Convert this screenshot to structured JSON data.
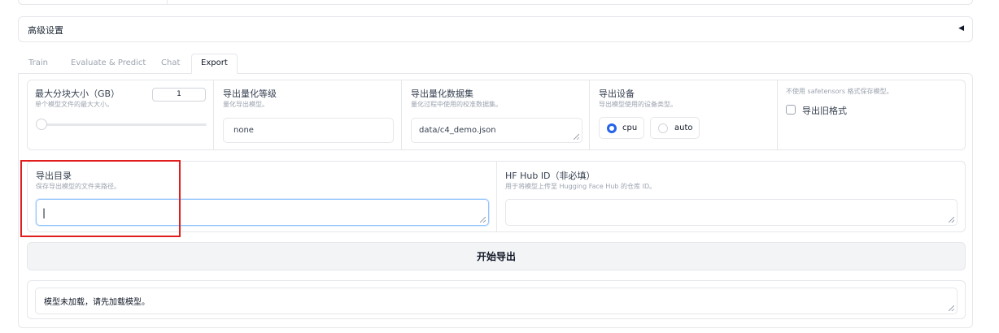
{
  "advanced": {
    "label": "高级设置",
    "toggle_icon": "◀"
  },
  "tabs": [
    {
      "label": "Train"
    },
    {
      "label": "Evaluate & Predict"
    },
    {
      "label": "Chat"
    },
    {
      "label": "Export"
    }
  ],
  "export": {
    "max_shard": {
      "title": "最大分块大小（GB）",
      "desc": "单个模型文件的最大大小。",
      "value": "1",
      "slider_fraction": 0.0
    },
    "quant_bit": {
      "title": "导出量化等级",
      "desc": "量化导出模型。",
      "value": "none"
    },
    "quant_dataset": {
      "title": "导出量化数据集",
      "desc": "量化过程中使用的校准数据集。",
      "value": "data/c4_demo.json"
    },
    "device": {
      "title": "导出设备",
      "desc": "导出模型使用的设备类型。",
      "options": [
        "cpu",
        "auto"
      ],
      "selected": "cpu"
    },
    "legacy": {
      "desc": "不使用 safetensors 格式保存模型。",
      "label": "导出旧格式",
      "checked": false
    },
    "export_dir": {
      "title": "导出目录",
      "desc": "保存导出模型的文件夹路径。",
      "value": "|"
    },
    "hub_id": {
      "title": "HF Hub ID（非必填）",
      "desc": "用于将模型上传至 Hugging Face Hub 的仓库 ID。",
      "value": ""
    },
    "start_label": "开始导出",
    "info_text": "模型未加载，请先加载模型。"
  },
  "colors": {
    "accent": "#2563eb",
    "highlight_box": "#e11d1d",
    "focus_border": "#93c5fd",
    "button_bg": "#f3f4f6"
  }
}
